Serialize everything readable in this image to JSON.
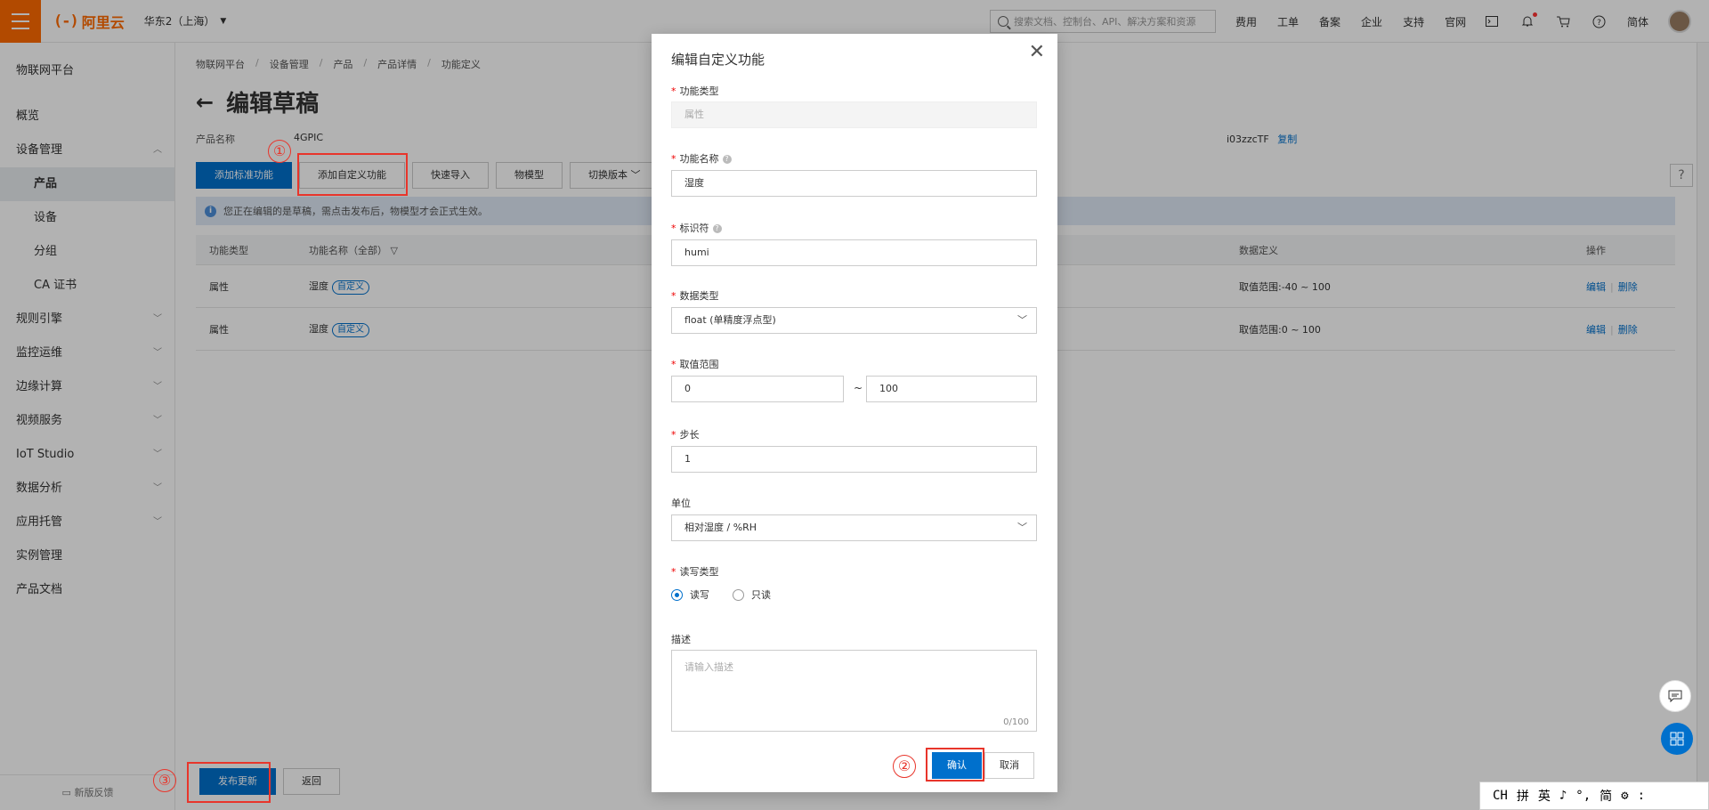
{
  "topbar": {
    "logo_mark": "(-)",
    "logo_text": "阿里云",
    "region": "华东2（上海）",
    "search_placeholder": "搜索文档、控制台、API、解决方案和资源",
    "nav": [
      "费用",
      "工单",
      "备案",
      "企业",
      "支持",
      "官网"
    ],
    "lang": "简体"
  },
  "sidebar": {
    "title": "物联网平台",
    "items": [
      {
        "label": "概览"
      },
      {
        "label": "设备管理",
        "chev": "︿"
      },
      {
        "label": "产品",
        "sub": true,
        "active": true
      },
      {
        "label": "设备",
        "sub": true
      },
      {
        "label": "分组",
        "sub": true
      },
      {
        "label": "CA 证书",
        "sub": true
      },
      {
        "label": "规则引擎",
        "chev": "﹀"
      },
      {
        "label": "监控运维",
        "chev": "﹀"
      },
      {
        "label": "边缘计算",
        "chev": "﹀"
      },
      {
        "label": "视频服务",
        "chev": "﹀"
      },
      {
        "label": "IoT Studio",
        "chev": "﹀"
      },
      {
        "label": "数据分析",
        "chev": "﹀"
      },
      {
        "label": "应用托管",
        "chev": "﹀"
      },
      {
        "label": "实例管理"
      },
      {
        "label": "产品文档"
      }
    ],
    "feedback": "新版反馈"
  },
  "main": {
    "breadcrumb": [
      "物联网平台",
      "设备管理",
      "产品",
      "产品详情",
      "功能定义"
    ],
    "title": "编辑草稿",
    "product_name_label": "产品名称",
    "product_name_value": "4GPIC",
    "product_key_suffix": "i03zzcTF",
    "copy_label": "复制",
    "buttons": {
      "add_standard": "添加标准功能",
      "add_custom": "添加自定义功能",
      "quick_import": "快速导入",
      "tsl_model": "物模型",
      "switch_version": "切换版本"
    },
    "notice": "您正在编辑的是草稿，需点击发布后，物模型才会正式生效。",
    "table": {
      "headers": {
        "type": "功能类型",
        "name": "功能名称（全部）",
        "data_def": "数据定义",
        "ops": "操作"
      },
      "rows": [
        {
          "type": "属性",
          "name": "湿度",
          "tag": "自定义",
          "data_def": "取值范围:-40 ~ 100",
          "edit": "编辑",
          "delete": "删除"
        },
        {
          "type": "属性",
          "name": "湿度",
          "tag": "自定义",
          "data_def": "取值范围:0 ~ 100",
          "edit": "编辑",
          "delete": "删除"
        }
      ]
    },
    "publish": "发布更新",
    "back": "返回"
  },
  "dialog": {
    "title": "编辑自定义功能",
    "function_type": {
      "label": "功能类型",
      "value": "属性"
    },
    "function_name": {
      "label": "功能名称",
      "value": "湿度"
    },
    "identifier": {
      "label": "标识符",
      "value": "humi"
    },
    "data_type": {
      "label": "数据类型",
      "value": "float (单精度浮点型)"
    },
    "range": {
      "label": "取值范围",
      "min": "0",
      "max": "100",
      "tilde": "~"
    },
    "step": {
      "label": "步长",
      "value": "1"
    },
    "unit": {
      "label": "单位",
      "value": "相对湿度 / %RH"
    },
    "rw_type": {
      "label": "读写类型",
      "options": [
        "读写",
        "只读"
      ],
      "selected": "读写"
    },
    "description": {
      "label": "描述",
      "placeholder": "请输入描述",
      "counter": "0/100"
    },
    "confirm": "确认",
    "cancel": "取消"
  },
  "annotations": [
    "①",
    "②",
    "③"
  ],
  "ime": [
    "CH",
    "拼",
    "英",
    "♪",
    "°,",
    "简",
    "⚙",
    ":"
  ]
}
